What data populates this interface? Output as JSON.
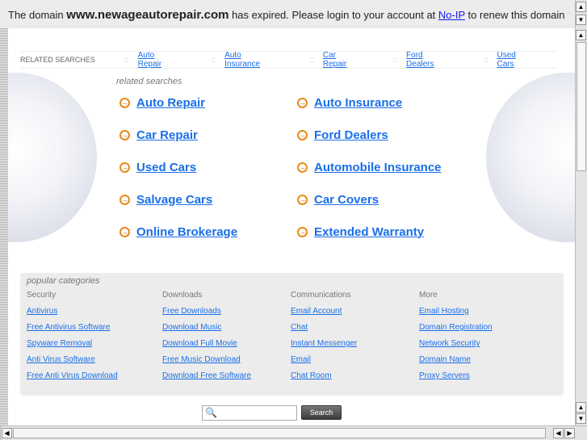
{
  "banner": {
    "prefix": "The domain",
    "domain": "www.newageautorepair.com",
    "middle": "has expired. Please login to your account at",
    "link": "No-IP",
    "suffix": "to renew this domain"
  },
  "related_bar": {
    "label": "RELATED SEARCHES",
    "sep": "::",
    "links": [
      "Auto Repair",
      "Auto Insurance",
      "Car Repair",
      "Ford Dealers",
      "Used Cars"
    ]
  },
  "related": {
    "heading": "related searches",
    "items": [
      "Auto Repair",
      "Auto Insurance",
      "Car Repair",
      "Ford Dealers",
      "Used Cars",
      "Automobile Insurance",
      "Salvage Cars",
      "Car Covers",
      "Online Brokerage",
      "Extended Warranty"
    ]
  },
  "popular": {
    "heading": "popular categories",
    "columns": [
      {
        "title": "Security",
        "links": [
          "Antivirus",
          "Free Antivirus Software",
          "Spyware Removal",
          "Anti Virus Software",
          "Free Anti Virus Download"
        ]
      },
      {
        "title": "Downloads",
        "links": [
          "Free Downloads",
          "Download Music",
          "Download Full Movie",
          "Free Music Download",
          "Download Free Software"
        ]
      },
      {
        "title": "Communications",
        "links": [
          "Email Account",
          "Chat",
          "Instant Messenger",
          "Email",
          "Chat Room"
        ]
      },
      {
        "title": "More",
        "links": [
          "Email Hosting",
          "Domain Registration",
          "Network Security",
          "Domain Name",
          "Proxy Servers"
        ]
      }
    ]
  },
  "search": {
    "button": "Search",
    "value": ""
  }
}
